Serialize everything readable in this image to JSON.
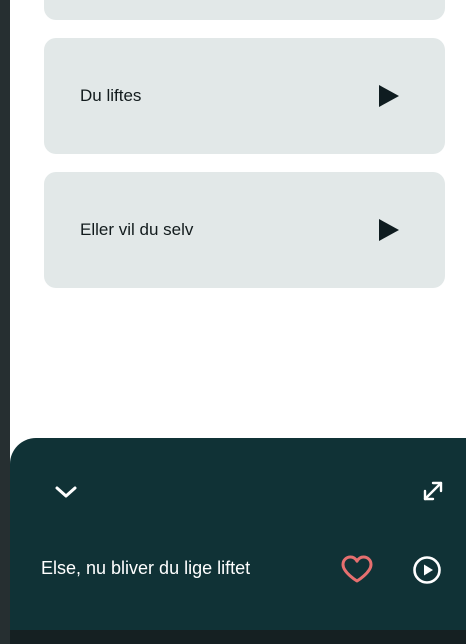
{
  "list": {
    "items": [
      {
        "label": "Du liftes",
        "icon": "play-triangle-icon"
      },
      {
        "label": "Eller vil du selv",
        "icon": "play-triangle-icon"
      }
    ]
  },
  "player": {
    "title": "Else, nu bliver du lige liftet",
    "icons": {
      "collapse": "chevron-down-icon",
      "expand": "expand-icon",
      "favorite": "heart-outline-icon",
      "play": "play-circle-icon"
    }
  },
  "colors": {
    "card_bg": "#e2e8e8",
    "player_bg": "#103236",
    "heart": "#e66f6f",
    "text_dark": "#121b1d"
  }
}
